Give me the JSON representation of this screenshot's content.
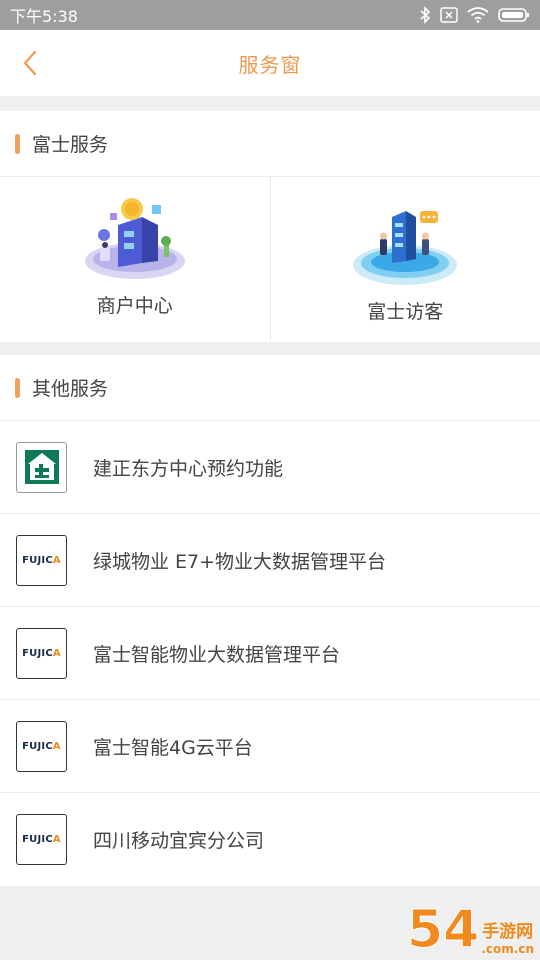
{
  "status_bar": {
    "time": "下午5:38",
    "icons": [
      "bluetooth-icon",
      "sim-off-icon",
      "wifi-icon",
      "battery-icon"
    ]
  },
  "nav": {
    "title": "服务窗",
    "back_icon": "chevron-left-icon"
  },
  "section_fuji": {
    "title": "富士服务",
    "cells": [
      {
        "label": "商户中心",
        "icon": "merchant-center-icon"
      },
      {
        "label": "富士访客",
        "icon": "visitor-icon"
      }
    ]
  },
  "section_other": {
    "title": "其他服务",
    "items": [
      {
        "label": "建正东方中心预约功能",
        "logo": "jianzheng-logo"
      },
      {
        "label": "绿城物业 E7+物业大数据管理平台",
        "logo": "fujica-logo"
      },
      {
        "label": "富士智能物业大数据管理平台",
        "logo": "fujica-logo"
      },
      {
        "label": "富士智能4G云平台",
        "logo": "fujica-logo"
      },
      {
        "label": "四川移动宜宾分公司",
        "logo": "fujica-logo"
      }
    ]
  },
  "fujica_logo_text": {
    "main": "FUJIC",
    "accent": "A"
  },
  "watermark": {
    "big": "54",
    "small_cn": "手游网",
    "small_domain": ".com.cn"
  },
  "colors": {
    "accent": "#ee9a4d",
    "section_bar": "#f0a15f",
    "status_bar": "#9e9e9e",
    "fujica_orange": "#f08a1e"
  }
}
